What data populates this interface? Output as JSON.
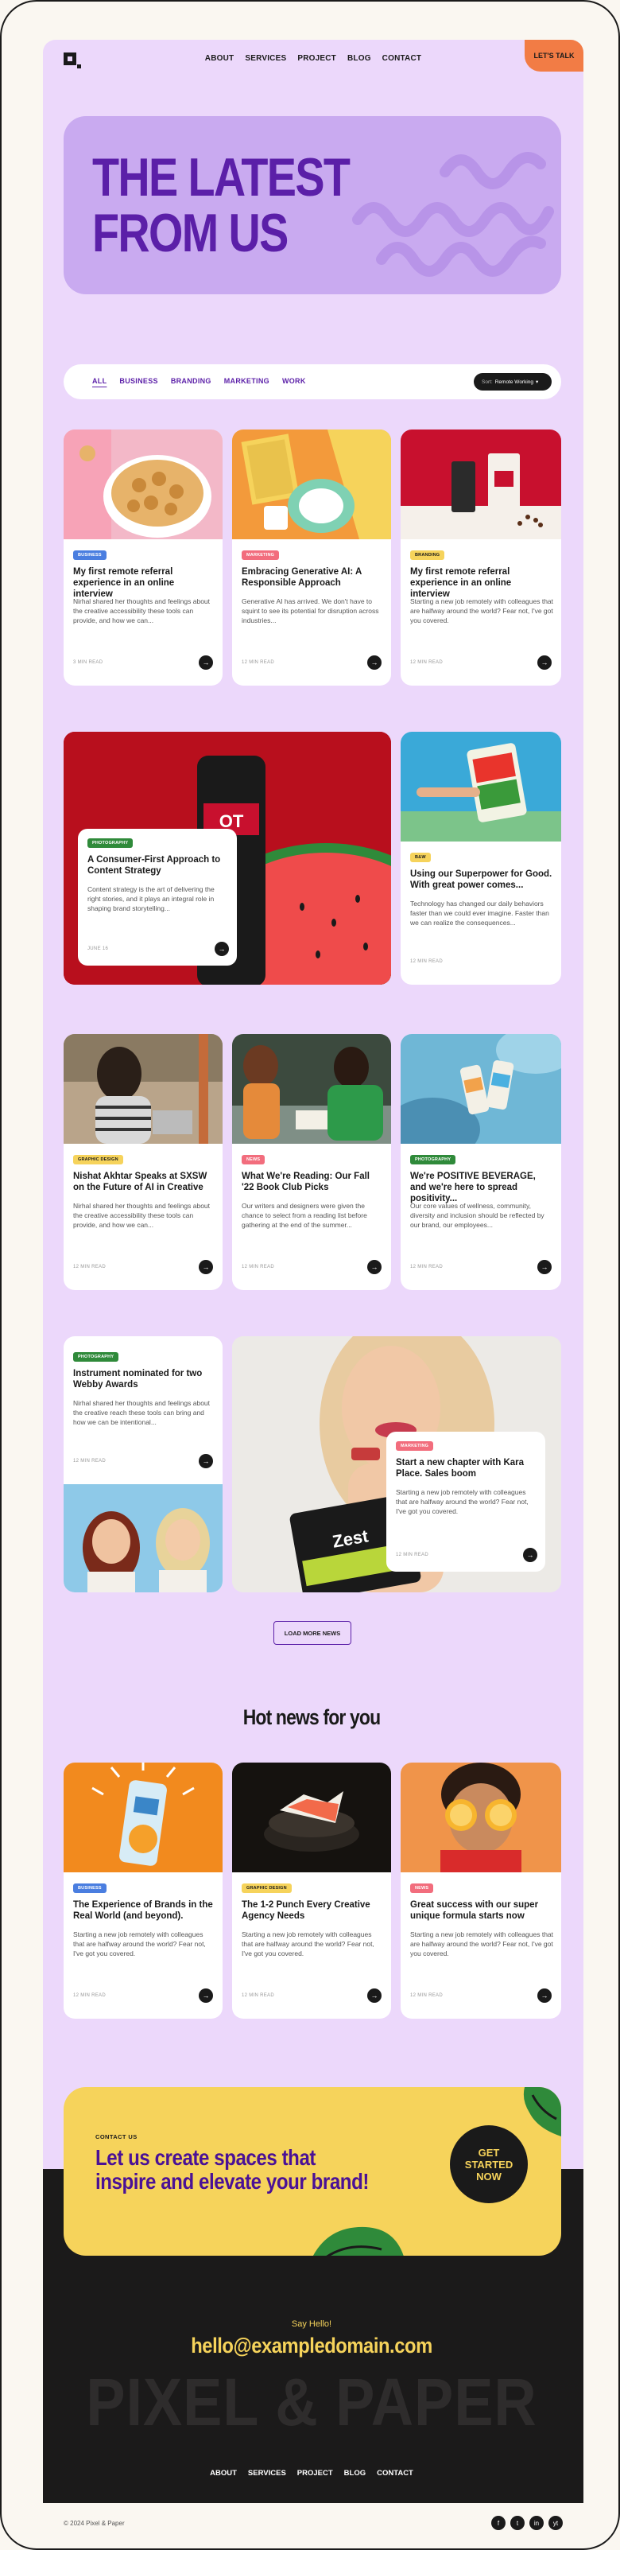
{
  "nav": {
    "links": [
      "ABOUT",
      "SERVICES",
      "PROJECT",
      "BLOG",
      "CONTACT"
    ],
    "cta": "LET'S TALK"
  },
  "hero": {
    "title": "THE LATEST\nFROM US"
  },
  "filter": {
    "tabs": [
      "ALL",
      "BUSINESS",
      "BRANDING",
      "MARKETING",
      "WORK"
    ],
    "sort_label": "Sort:",
    "sort_value": "Remote Working"
  },
  "posts": [
    {
      "badge": "BUSINESS",
      "title": "My first remote referral experience in an online interview",
      "excerpt": "Nirhal shared her thoughts and feelings about the creative accessibility these tools can provide, and how we can...",
      "meta": "3 MIN READ"
    },
    {
      "badge": "MARKETING",
      "title": "Embracing Generative AI: A Responsible Approach",
      "excerpt": "Generative AI has arrived. We don't have to squint to see its potential for disruption across industries...",
      "meta": "12 MIN READ"
    },
    {
      "badge": "BRANDING",
      "title": "My first remote referral experience in an online interview",
      "excerpt": "Starting a new job remotely with colleagues that are halfway around the world? Fear not, I've got you covered.",
      "meta": "12 MIN READ"
    },
    {
      "badge": "PHOTOGRAPHY",
      "title": "A Consumer-First Approach to Content Strategy",
      "excerpt": "Content strategy is the art of delivering the right stories, and it plays an integral role in shaping brand storytelling...",
      "meta": "JUNE 16"
    },
    {
      "badge": "B&W",
      "title": "Using our Superpower for Good. With great power comes...",
      "excerpt": "Technology has changed our daily behaviors faster than we could ever imagine. Faster than we can realize the consequences...",
      "meta": "12 MIN READ"
    },
    {
      "badge": "GRAPHIC DESIGN",
      "title": "Nishat Akhtar Speaks at SXSW on the Future of AI in Creative",
      "excerpt": "Nirhal shared her thoughts and feelings about the creative accessibility these tools can provide, and how we can...",
      "meta": "12 MIN READ"
    },
    {
      "badge": "NEWS",
      "title": "What We're Reading: Our Fall '22 Book Club Picks",
      "excerpt": "Our writers and designers were given the chance to select from a reading list before gathering at the end of the summer...",
      "meta": "12 MIN READ"
    },
    {
      "badge": "PHOTOGRAPHY",
      "title": "We're POSITIVE BEVERAGE, and we're here to spread positivity...",
      "excerpt": "Our core values of wellness, community, diversity and inclusion should be reflected by our brand, our employees...",
      "meta": "12 MIN READ"
    },
    {
      "badge": "PHOTOGRAPHY",
      "title": "Instrument nominated for two Webby Awards",
      "excerpt": "Nirhal shared her thoughts and feelings about the creative reach these tools can bring and how we can be intentional...",
      "meta": "12 MIN READ"
    },
    {
      "badge": "MARKETING",
      "title": "Start a new chapter with Kara Place. Sales boom",
      "excerpt": "Starting a new job remotely with colleagues that are halfway around the world? Fear not, I've got you covered.",
      "meta": "12 MIN READ"
    }
  ],
  "load_more": "LOAD MORE NEWS",
  "hot_news": {
    "title": "Hot news for you",
    "posts": [
      {
        "badge": "BUSINESS",
        "title": "The Experience of Brands in the Real World (and beyond).",
        "excerpt": "Starting a new job remotely with colleagues that are halfway around the world? Fear not, I've got you covered.",
        "meta": "12 MIN READ"
      },
      {
        "badge": "GRAPHIC DESIGN",
        "title": "The 1-2 Punch Every Creative Agency Needs",
        "excerpt": "Starting a new job remotely with colleagues that are halfway around the world? Fear not, I've got you covered.",
        "meta": "12 MIN READ"
      },
      {
        "badge": "NEWS",
        "title": "Great success with our super unique formula starts now",
        "excerpt": "Starting a new job remotely with colleagues that are halfway around the world? Fear not, I've got you covered.",
        "meta": "12 MIN READ"
      }
    ]
  },
  "cta": {
    "eyebrow": "CONTACT US",
    "title": "Let us create spaces that\ninspire and elevate your brand!",
    "button": "GET\nSTARTED\nNOW"
  },
  "footer": {
    "say_hello": "Say Hello!",
    "email": "hello@exampledomain.com",
    "brand": "PIXEL & PAPER",
    "links": [
      "ABOUT",
      "SERVICES",
      "PROJECT",
      "BLOG",
      "CONTACT"
    ],
    "copyright": "© 2024 Pixel & Paper",
    "socials": [
      "f",
      "t",
      "in",
      "yt"
    ]
  },
  "colors": {
    "page_bg": "#ecd8fb",
    "accent_purple": "#5b1fa8",
    "hero_bg": "#c9aaf0",
    "cta_yellow": "#f6d35b",
    "talk_orange": "#f27c45",
    "footer_bg": "#1b1a1a"
  },
  "icons": [
    "logo-mark",
    "arrow-right-icon",
    "facebook-icon",
    "twitter-icon",
    "instagram-icon",
    "youtube-icon"
  ]
}
